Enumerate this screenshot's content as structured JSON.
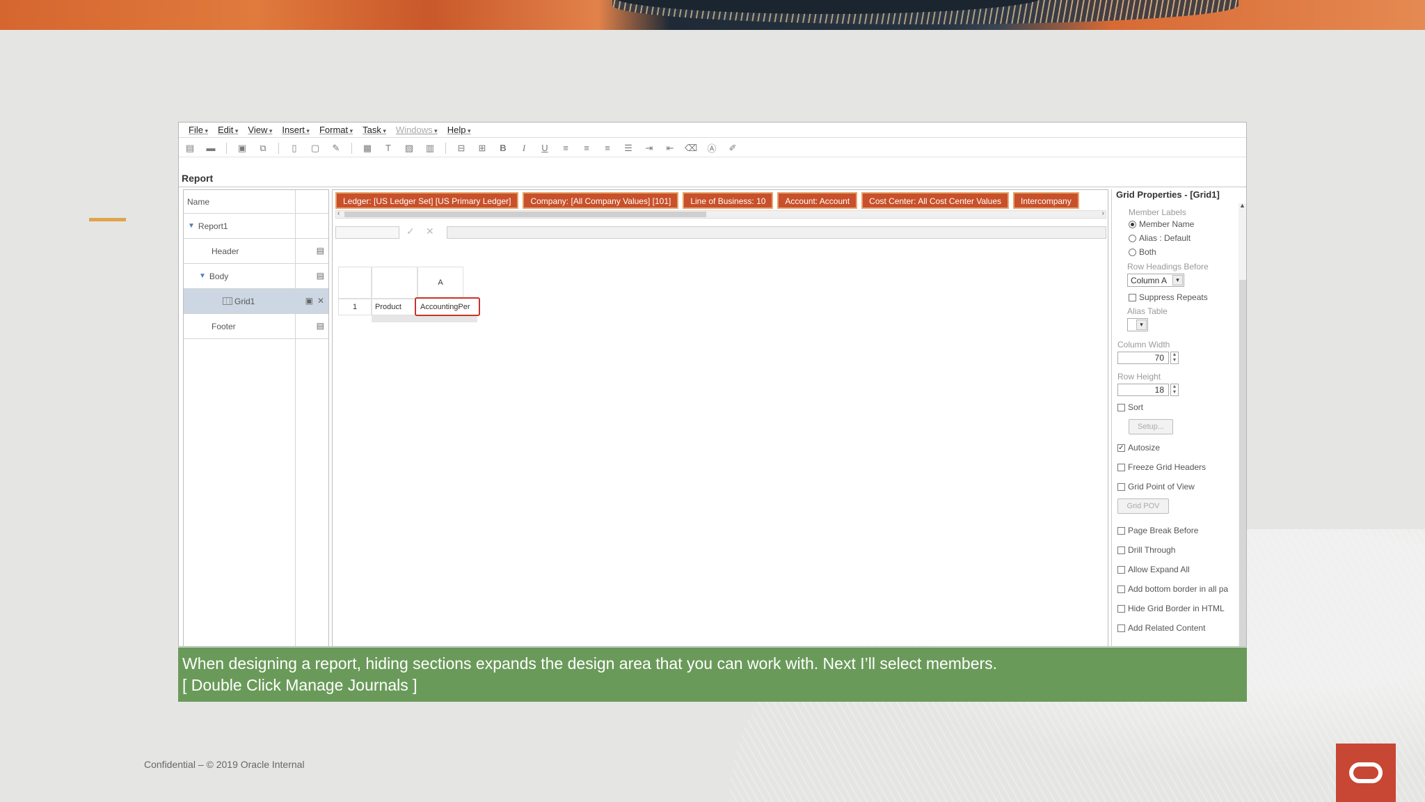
{
  "menu": [
    {
      "label": "File",
      "disabled": false
    },
    {
      "label": "Edit",
      "disabled": false
    },
    {
      "label": "View",
      "disabled": false
    },
    {
      "label": "Insert",
      "disabled": false
    },
    {
      "label": "Format",
      "disabled": false
    },
    {
      "label": "Task",
      "disabled": false
    },
    {
      "label": "Windows",
      "disabled": true
    },
    {
      "label": "Help",
      "disabled": false
    }
  ],
  "toolbar": {
    "icons": [
      "new-report-icon",
      "open-folder-icon",
      "save-icon",
      "save-as-icon",
      "print-preview-icon",
      "export-icon",
      "edit-icon",
      "insert-grid-icon",
      "insert-text-icon",
      "insert-image-icon",
      "insert-chart-icon",
      "merge-icon",
      "split-icon",
      "bold-icon",
      "italic-icon",
      "underline-icon",
      "align-left-icon",
      "align-center-icon",
      "align-right-icon",
      "justify-icon",
      "indent-icon",
      "outdent-icon",
      "clear-format-icon",
      "font-icon",
      "format-painter-icon"
    ],
    "glyphs": {
      "bold": "B",
      "italic": "I",
      "underline": "U"
    }
  },
  "report": {
    "title": "Report",
    "tree_header": "Name",
    "items": [
      {
        "label": "Report1"
      },
      {
        "label": "Header"
      },
      {
        "label": "Body"
      },
      {
        "label": "Grid1"
      },
      {
        "label": "Footer"
      }
    ]
  },
  "pov": [
    "Ledger: [US Ledger Set] [US Primary Ledger]",
    "Company: [All Company Values] [101]",
    "Line of Business: 10",
    "Account: Account",
    "Cost Center: All Cost Center Values",
    "Intercompany"
  ],
  "grid": {
    "column_header": "A",
    "row_number": "1",
    "row_label": "Product",
    "selected_cell": "AccountingPer"
  },
  "properties": {
    "title": "Grid Properties - [Grid1]",
    "member_labels_label": "Member Labels",
    "member_name": "Member Name",
    "alias_default": "Alias : Default",
    "both": "Both",
    "row_headings_before_label": "Row Headings Before",
    "row_headings_before_value": "Column A",
    "suppress_repeats": "Suppress Repeats",
    "alias_table_label": "Alias Table",
    "column_width_label": "Column Width",
    "column_width_value": "70",
    "row_height_label": "Row Height",
    "row_height_value": "18",
    "sort": "Sort",
    "setup_button": "Setup...",
    "autosize": "Autosize",
    "freeze_grid_headers": "Freeze Grid Headers",
    "grid_point_of_view": "Grid Point of View",
    "grid_pov_button": "Grid POV",
    "page_break_before": "Page Break Before",
    "drill_through": "Drill Through",
    "allow_expand_all": "Allow Expand All",
    "add_bottom_border": "Add bottom border in all pa",
    "hide_grid_border": "Hide Grid Border in HTML",
    "add_related_content": "Add Related Content"
  },
  "caption": {
    "line1": "When designing a report, hiding sections expands the design area that you can work with. Next I’ll select members.",
    "line2": "[ Double Click Manage Journals ]"
  },
  "footer": "Confidential – © 2019 Oracle Internal",
  "colors": {
    "accent": "#c8502a",
    "caption_bg": "#6a9a5a",
    "logo": "#c74634",
    "selected_cell_border": "#c8332a"
  }
}
